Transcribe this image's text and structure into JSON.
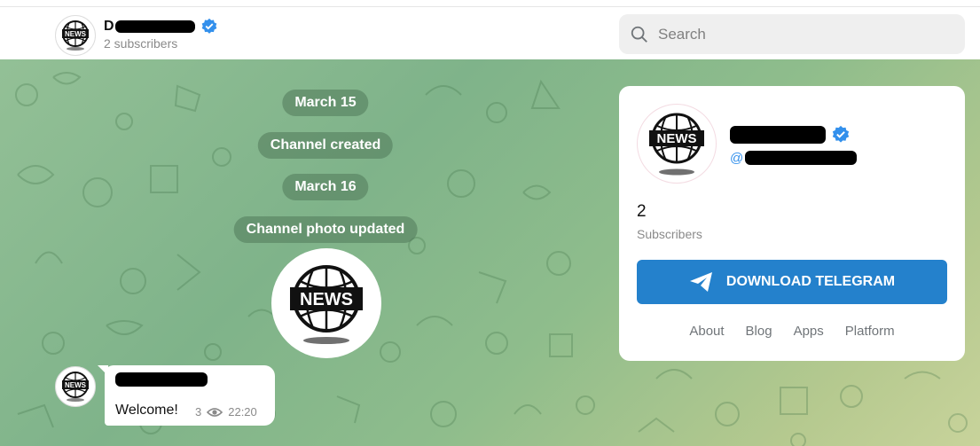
{
  "header": {
    "channel_title": "D",
    "subscribers": "2 subscribers",
    "search_placeholder": "Search"
  },
  "chat": {
    "service_messages": [
      {
        "text": "March 15"
      },
      {
        "text": "Channel created"
      },
      {
        "text": "March 16"
      },
      {
        "text": "Channel photo updated"
      }
    ],
    "channel_photo_text": "NEWS",
    "message": {
      "text": "Welcome!",
      "views": "3",
      "time": "22:20"
    },
    "background_colors": [
      "#93c096",
      "#7fb38a",
      "#b5c98f",
      "#c8d39b"
    ]
  },
  "card": {
    "handle_prefix": "@",
    "subscriber_count": "2",
    "subscriber_label": "Subscribers",
    "download_label": "DOWNLOAD TELEGRAM",
    "links": [
      "About",
      "Blog",
      "Apps",
      "Platform"
    ]
  },
  "colors": {
    "accent": "#2481cc",
    "verified": "#3390ec",
    "service_bg": "rgba(80,120,90,0.55)"
  },
  "logo_text": "NEWS"
}
